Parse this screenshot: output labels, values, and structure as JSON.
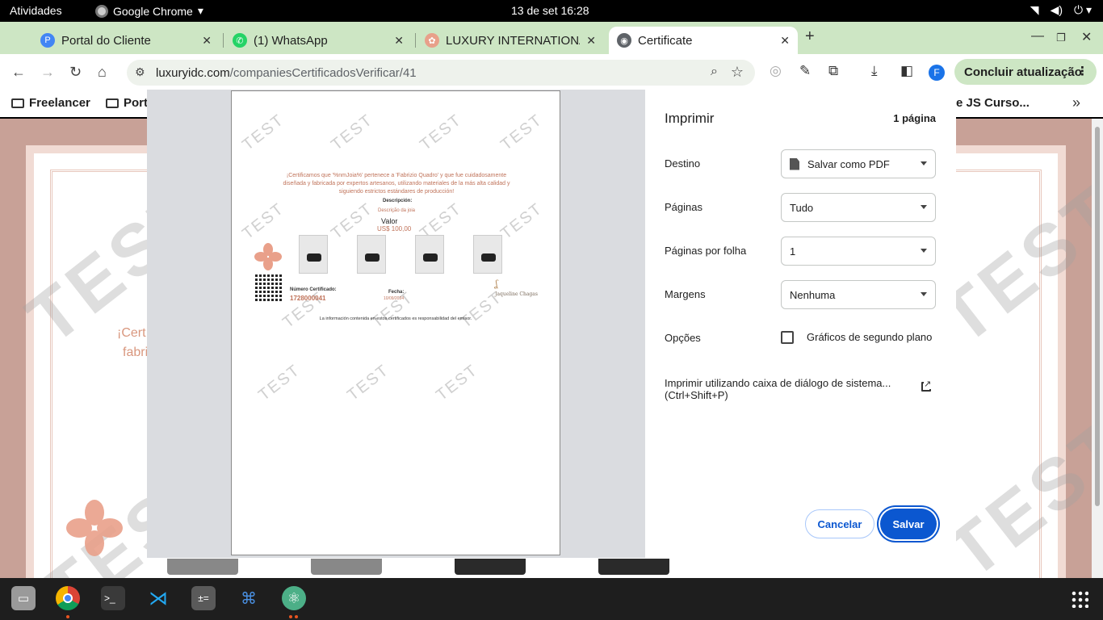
{
  "topbar": {
    "activities": "Atividades",
    "app_name": "Google Chrome",
    "app_arrow": "▾",
    "clock": "13 de set  16:28",
    "tray": [
      "wifi-icon",
      "volume-icon",
      "power-icon"
    ]
  },
  "tabs": [
    {
      "label": "Portal do Cliente",
      "icon": "portal-icon",
      "color": "#4285f4",
      "active": false
    },
    {
      "label": "(1) WhatsApp",
      "icon": "whatsapp-icon",
      "color": "#25d366",
      "active": false
    },
    {
      "label": "LUXURY INTERNATIONA",
      "icon": "luxury-icon",
      "color": "#e8a08a",
      "active": false
    },
    {
      "label": "Certificate",
      "icon": "globe-icon",
      "color": "#5f6368",
      "active": true
    }
  ],
  "tab_close": "✕",
  "toolbar": {
    "url_host": "luxuryidc.com",
    "url_path": "/companiesCertificadosVerificar/41",
    "update_label": "Concluir atualização",
    "profile_initial": "F"
  },
  "bookmarks": {
    "items": [
      "Freelancer",
      "Port"
    ],
    "right_item": "e JS Curso..."
  },
  "background_page": {
    "text_line1": "¡Cert",
    "text_line2": "fabri"
  },
  "preview": {
    "watermark": "TEST",
    "intro": "¡Certificamos que '%nmJoia%' pertenece a 'Fabrizio Quadro' y que fue cuidadosamente diseñada y fabricada por expertos artesanos, utilizando materiales de la más alta calidad y siguiendo estrictos estándares de producción!",
    "description_label": "Descripción:",
    "description_value": "Descrição da joia",
    "value_label": "Valor",
    "value_amount": "US$ 100,00",
    "cert_number_label": "Número Certificado:",
    "cert_number": "1728000041",
    "date_label": "Fecha:",
    "date_value": "10/09/2024",
    "signature": "Jaqueline Chagas",
    "footer": "La información contenida en estos certificados es responsabilidad del emisor."
  },
  "print": {
    "title": "Imprimir",
    "page_count": "1 página",
    "destination_label": "Destino",
    "destination_value": "Salvar como PDF",
    "pages_label": "Páginas",
    "pages_value": "Tudo",
    "per_sheet_label": "Páginas por folha",
    "per_sheet_value": "1",
    "margins_label": "Margens",
    "margins_value": "Nenhuma",
    "options_label": "Opções",
    "background_graphics": "Gráficos de segundo plano",
    "system_dialog_line1": "Imprimir utilizando caixa de diálogo de sistema...",
    "system_dialog_line2": "(Ctrl+Shift+P)",
    "cancel": "Cancelar",
    "save": "Salvar"
  },
  "dock": [
    "files-icon",
    "chrome-icon",
    "terminal-icon",
    "vscode-icon",
    "calculator-icon",
    "network-icon",
    "atom-icon"
  ]
}
